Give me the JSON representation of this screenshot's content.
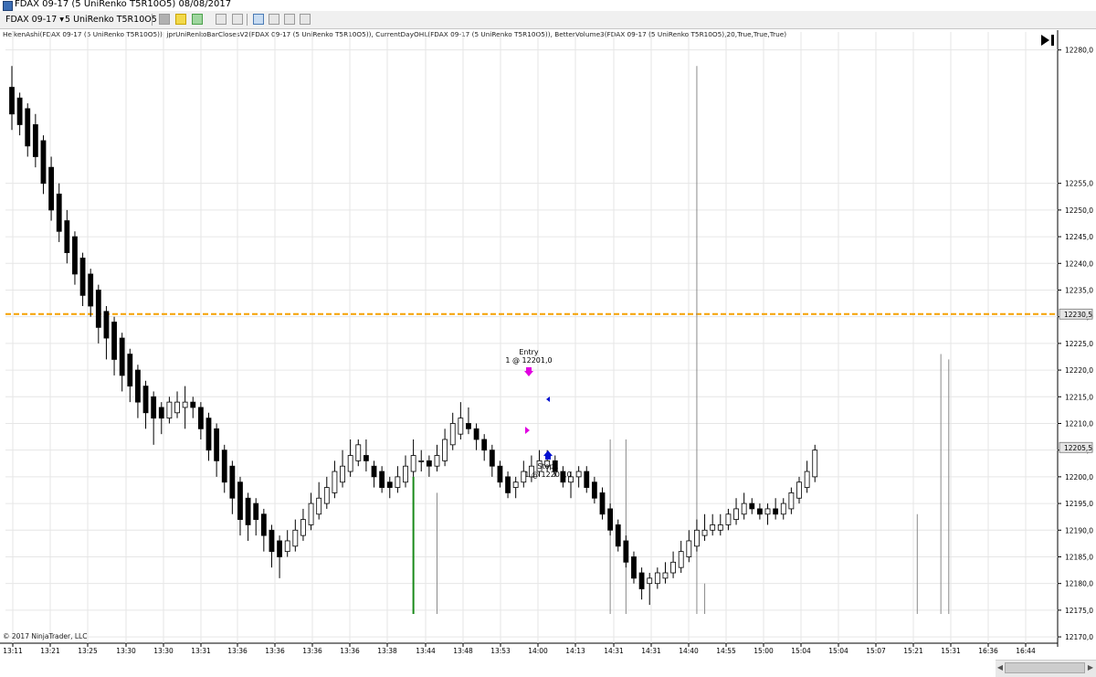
{
  "window": {
    "title": "FDAX 09-17 (5 UniRenko T5R10O5)  08/08/2017"
  },
  "toolbar": {
    "instrument": "FDAX 09-17",
    "period": "5 UniRenko T5R10O5"
  },
  "indicators_text": "HeikenAshi(FDAX 09-17 (5 UniRenko T5R10O5)), jprUniRenkoBarClosesV2(FDAX 09-17 (5 UniRenko T5R10O5)), CurrentDayOHL(FDAX 09-17 (5 UniRenko T5R10O5)), BetterVolume3(FDAX 09-17 (5 UniRenko T5R10O5),20,True,True,True)",
  "copyright": "© 2017 NinjaTrader, LLC",
  "colors": {
    "orange_line": "#f5a000",
    "grid": "#e6e6e6",
    "entry_arrow": "#e000e0",
    "stop_arrow": "#0010d0",
    "volume_green": "#1a8a1a"
  },
  "icons": [
    "chart-style-icon",
    "draw-pencil-icon",
    "draw-tools-icon",
    "crosshair-icon",
    "data-box-icon",
    "indicators-icon",
    "strategies-icon",
    "properties-icon"
  ],
  "chart_data": {
    "type": "candlestick",
    "instrument": "FDAX 09-17",
    "bar_type": "5 UniRenko T5R10O5",
    "date": "08/08/2017",
    "ylim": [
      12170,
      12282
    ],
    "y_ticks": [
      "12280,0",
      "12255,0",
      "12250,0",
      "12245,0",
      "12240,0",
      "12235,0",
      "12230,0",
      "12225,0",
      "12220,0",
      "12215,0",
      "12210,0",
      "12205,0",
      "12200,0",
      "12195,0",
      "12190,0",
      "12185,0",
      "12180,0",
      "12175,0",
      "12170,0"
    ],
    "x_labels": [
      "13:11",
      "13:21",
      "13:25",
      "13:30",
      "13:30",
      "13:31",
      "13:36",
      "13:36",
      "13:36",
      "13:36",
      "13:38",
      "13:44",
      "13:48",
      "13:53",
      "14:00",
      "14:13",
      "14:31",
      "14:31",
      "14:40",
      "14:55",
      "15:00",
      "15:04",
      "15:04",
      "15:07",
      "15:21",
      "15:31",
      "16:36",
      "16:44"
    ],
    "current_day_open": {
      "value": 12230.5,
      "label": "12230,5"
    },
    "last_price": {
      "value": 12205.5,
      "label": "12205,5"
    },
    "orders": [
      {
        "name": "Entry",
        "text": "1 @ 12201,0",
        "price": 12201.0
      },
      {
        "name": "Stop1",
        "text": "1 @ 12206,0",
        "price": 12206.0
      }
    ],
    "candles": [
      {
        "o": 12273,
        "h": 12277,
        "l": 12265,
        "c": 12268
      },
      {
        "o": 12271,
        "h": 12272,
        "l": 12264,
        "c": 12266
      },
      {
        "o": 12269,
        "h": 12270,
        "l": 12260,
        "c": 12262
      },
      {
        "o": 12266,
        "h": 12268,
        "l": 12258,
        "c": 12260
      },
      {
        "o": 12263,
        "h": 12264,
        "l": 12253,
        "c": 12255
      },
      {
        "o": 12258,
        "h": 12260,
        "l": 12248,
        "c": 12250
      },
      {
        "o": 12253,
        "h": 12255,
        "l": 12244,
        "c": 12246
      },
      {
        "o": 12248,
        "h": 12250,
        "l": 12240,
        "c": 12242
      },
      {
        "o": 12245,
        "h": 12246,
        "l": 12236,
        "c": 12238
      },
      {
        "o": 12241,
        "h": 12242,
        "l": 12232,
        "c": 12234
      },
      {
        "o": 12238,
        "h": 12239,
        "l": 12230,
        "c": 12232
      },
      {
        "o": 12235,
        "h": 12236,
        "l": 12225,
        "c": 12228
      },
      {
        "o": 12231,
        "h": 12232,
        "l": 12222,
        "c": 12226
      },
      {
        "o": 12229,
        "h": 12230,
        "l": 12219,
        "c": 12222
      },
      {
        "o": 12226,
        "h": 12227,
        "l": 12216,
        "c": 12219
      },
      {
        "o": 12223,
        "h": 12224,
        "l": 12214,
        "c": 12217
      },
      {
        "o": 12220,
        "h": 12221,
        "l": 12211,
        "c": 12214
      },
      {
        "o": 12217,
        "h": 12218,
        "l": 12209,
        "c": 12212
      },
      {
        "o": 12215,
        "h": 12216,
        "l": 12206,
        "c": 12211
      },
      {
        "o": 12213,
        "h": 12214,
        "l": 12208,
        "c": 12211
      },
      {
        "o": 12211,
        "h": 12215,
        "l": 12210,
        "c": 12214
      },
      {
        "o": 12212,
        "h": 12216,
        "l": 12211,
        "c": 12214
      },
      {
        "o": 12213,
        "h": 12217,
        "l": 12209,
        "c": 12214
      },
      {
        "o": 12214,
        "h": 12215,
        "l": 12211,
        "c": 12213
      },
      {
        "o": 12213,
        "h": 12214,
        "l": 12207,
        "c": 12209
      },
      {
        "o": 12211,
        "h": 12212,
        "l": 12203,
        "c": 12205
      },
      {
        "o": 12209,
        "h": 12210,
        "l": 12200,
        "c": 12203
      },
      {
        "o": 12205,
        "h": 12206,
        "l": 12197,
        "c": 12199
      },
      {
        "o": 12202,
        "h": 12203,
        "l": 12193,
        "c": 12196
      },
      {
        "o": 12199,
        "h": 12200,
        "l": 12189,
        "c": 12192
      },
      {
        "o": 12196,
        "h": 12197,
        "l": 12188,
        "c": 12191
      },
      {
        "o": 12195,
        "h": 12196,
        "l": 12189,
        "c": 12192
      },
      {
        "o": 12193,
        "h": 12194,
        "l": 12186,
        "c": 12189
      },
      {
        "o": 12190,
        "h": 12191,
        "l": 12183,
        "c": 12186
      },
      {
        "o": 12188,
        "h": 12189,
        "l": 12181,
        "c": 12185
      },
      {
        "o": 12186,
        "h": 12190,
        "l": 12185,
        "c": 12188
      },
      {
        "o": 12187,
        "h": 12192,
        "l": 12186,
        "c": 12190
      },
      {
        "o": 12189,
        "h": 12194,
        "l": 12188,
        "c": 12192
      },
      {
        "o": 12191,
        "h": 12197,
        "l": 12190,
        "c": 12195
      },
      {
        "o": 12193,
        "h": 12199,
        "l": 12192,
        "c": 12196
      },
      {
        "o": 12195,
        "h": 12200,
        "l": 12194,
        "c": 12198
      },
      {
        "o": 12197,
        "h": 12203,
        "l": 12196,
        "c": 12201
      },
      {
        "o": 12199,
        "h": 12205,
        "l": 12198,
        "c": 12202
      },
      {
        "o": 12201,
        "h": 12207,
        "l": 12200,
        "c": 12204
      },
      {
        "o": 12203,
        "h": 12207,
        "l": 12202,
        "c": 12206
      },
      {
        "o": 12204,
        "h": 12207,
        "l": 12201,
        "c": 12203
      },
      {
        "o": 12202,
        "h": 12203,
        "l": 12198,
        "c": 12200
      },
      {
        "o": 12201,
        "h": 12202,
        "l": 12197,
        "c": 12198
      },
      {
        "o": 12199,
        "h": 12200,
        "l": 12196,
        "c": 12198
      },
      {
        "o": 12198,
        "h": 12202,
        "l": 12197,
        "c": 12200
      },
      {
        "o": 12199,
        "h": 12204,
        "l": 12198,
        "c": 12202
      },
      {
        "o": 12201,
        "h": 12207,
        "l": 12200,
        "c": 12204
      },
      {
        "o": 12203,
        "h": 12205,
        "l": 12201,
        "c": 12203
      },
      {
        "o": 12203,
        "h": 12204,
        "l": 12200,
        "c": 12202
      },
      {
        "o": 12202,
        "h": 12206,
        "l": 12201,
        "c": 12204
      },
      {
        "o": 12203,
        "h": 12209,
        "l": 12202,
        "c": 12207
      },
      {
        "o": 12206,
        "h": 12212,
        "l": 12205,
        "c": 12210
      },
      {
        "o": 12208,
        "h": 12214,
        "l": 12207,
        "c": 12211
      },
      {
        "o": 12210,
        "h": 12213,
        "l": 12208,
        "c": 12209
      },
      {
        "o": 12209,
        "h": 12210,
        "l": 12205,
        "c": 12207
      },
      {
        "o": 12207,
        "h": 12208,
        "l": 12203,
        "c": 12205
      },
      {
        "o": 12205,
        "h": 12206,
        "l": 12200,
        "c": 12202
      },
      {
        "o": 12202,
        "h": 12203,
        "l": 12198,
        "c": 12199
      },
      {
        "o": 12200,
        "h": 12201,
        "l": 12196,
        "c": 12197
      },
      {
        "o": 12198,
        "h": 12200,
        "l": 12196,
        "c": 12199
      },
      {
        "o": 12199,
        "h": 12203,
        "l": 12198,
        "c": 12201
      },
      {
        "o": 12200,
        "h": 12204,
        "l": 12199,
        "c": 12202
      },
      {
        "o": 12201,
        "h": 12205,
        "l": 12200,
        "c": 12203
      },
      {
        "o": 12202,
        "h": 12205,
        "l": 12201,
        "c": 12203
      },
      {
        "o": 12203,
        "h": 12204,
        "l": 12200,
        "c": 12201
      },
      {
        "o": 12201,
        "h": 12202,
        "l": 12198,
        "c": 12199
      },
      {
        "o": 12199,
        "h": 12201,
        "l": 12196,
        "c": 12200
      },
      {
        "o": 12200,
        "h": 12202,
        "l": 12198,
        "c": 12201
      },
      {
        "o": 12201,
        "h": 12202,
        "l": 12197,
        "c": 12198
      },
      {
        "o": 12199,
        "h": 12200,
        "l": 12195,
        "c": 12196
      },
      {
        "o": 12197,
        "h": 12198,
        "l": 12192,
        "c": 12193
      },
      {
        "o": 12194,
        "h": 12195,
        "l": 12189,
        "c": 12190
      },
      {
        "o": 12191,
        "h": 12192,
        "l": 12186,
        "c": 12187
      },
      {
        "o": 12188,
        "h": 12189,
        "l": 12183,
        "c": 12184
      },
      {
        "o": 12185,
        "h": 12186,
        "l": 12180,
        "c": 12181
      },
      {
        "o": 12182,
        "h": 12183,
        "l": 12177,
        "c": 12179
      },
      {
        "o": 12180,
        "h": 12182,
        "l": 12176,
        "c": 12181
      },
      {
        "o": 12180,
        "h": 12183,
        "l": 12179,
        "c": 12182
      },
      {
        "o": 12181,
        "h": 12184,
        "l": 12180,
        "c": 12182
      },
      {
        "o": 12182,
        "h": 12186,
        "l": 12181,
        "c": 12184
      },
      {
        "o": 12183,
        "h": 12188,
        "l": 12182,
        "c": 12186
      },
      {
        "o": 12185,
        "h": 12190,
        "l": 12184,
        "c": 12188
      },
      {
        "o": 12187,
        "h": 12192,
        "l": 12186,
        "c": 12190
      },
      {
        "o": 12189,
        "h": 12193,
        "l": 12188,
        "c": 12190
      },
      {
        "o": 12190,
        "h": 12193,
        "l": 12189,
        "c": 12191
      },
      {
        "o": 12190,
        "h": 12193,
        "l": 12189,
        "c": 12191
      },
      {
        "o": 12191,
        "h": 12194,
        "l": 12190,
        "c": 12193
      },
      {
        "o": 12192,
        "h": 12196,
        "l": 12191,
        "c": 12194
      },
      {
        "o": 12193,
        "h": 12197,
        "l": 12192,
        "c": 12195
      },
      {
        "o": 12195,
        "h": 12196,
        "l": 12193,
        "c": 12194
      },
      {
        "o": 12194,
        "h": 12195,
        "l": 12192,
        "c": 12193
      },
      {
        "o": 12193,
        "h": 12195,
        "l": 12191,
        "c": 12194
      },
      {
        "o": 12194,
        "h": 12196,
        "l": 12192,
        "c": 12193
      },
      {
        "o": 12193,
        "h": 12196,
        "l": 12192,
        "c": 12195
      },
      {
        "o": 12194,
        "h": 12198,
        "l": 12193,
        "c": 12197
      },
      {
        "o": 12196,
        "h": 12200,
        "l": 12195,
        "c": 12199
      },
      {
        "o": 12198,
        "h": 12203,
        "l": 12197,
        "c": 12201
      },
      {
        "o": 12200,
        "h": 12206,
        "l": 12199,
        "c": 12205
      }
    ],
    "volume_spikes": [
      {
        "i": 51,
        "top": 12200,
        "color": "green"
      },
      {
        "i": 54,
        "top": 12197,
        "color": "gray"
      },
      {
        "i": 76,
        "top": 12207,
        "color": "gray"
      },
      {
        "i": 78,
        "top": 12207,
        "color": "gray"
      },
      {
        "i": 87,
        "top": 12277,
        "color": "gray"
      },
      {
        "i": 88,
        "top": 12180,
        "color": "gray"
      },
      {
        "i": 115,
        "top": 12193,
        "color": "gray"
      },
      {
        "i": 118,
        "top": 12223,
        "color": "gray"
      },
      {
        "i": 119,
        "top": 12222,
        "color": "gray"
      }
    ]
  }
}
